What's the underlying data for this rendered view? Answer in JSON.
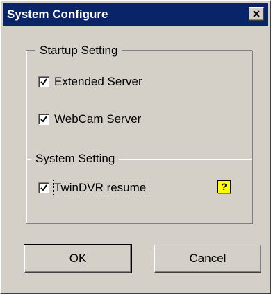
{
  "window": {
    "title": "System Configure"
  },
  "icons": {
    "close": "close-icon",
    "help": "help-icon",
    "check": "checkmark-icon"
  },
  "startup": {
    "legend": "Startup Setting",
    "items": [
      {
        "label": "Extended Server",
        "checked": true
      },
      {
        "label": "WebCam Server",
        "checked": true
      }
    ]
  },
  "system": {
    "legend": "System Setting",
    "items": [
      {
        "label": "TwinDVR resume",
        "checked": true
      }
    ],
    "help_glyph": "?"
  },
  "buttons": {
    "ok": "OK",
    "cancel": "Cancel"
  },
  "colors": {
    "titlebar": "#0a246a",
    "face": "#d4d0c8",
    "help_bg": "#ffff00"
  }
}
